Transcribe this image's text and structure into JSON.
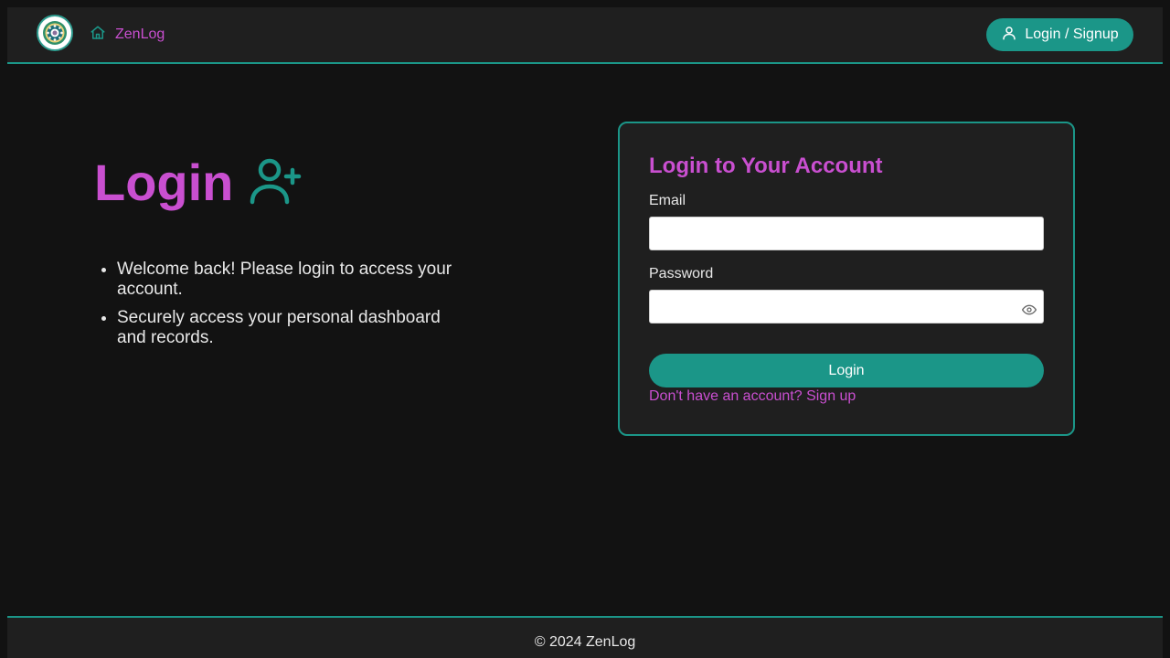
{
  "navbar": {
    "logo_icon": "mandala-logo-icon",
    "home_icon": "home-icon",
    "brand": "ZenLog",
    "button_icon": "user-icon",
    "button_label": "Login / Signup"
  },
  "hero": {
    "title": "Login",
    "title_icon": "user-plus-icon",
    "bullets": [
      "Welcome back! Please login to access your account.",
      "Securely access your personal dashboard and records."
    ]
  },
  "form": {
    "title": "Login to Your Account",
    "email_label": "Email",
    "email_value": "",
    "password_label": "Password",
    "password_value": "",
    "password_toggle_icon": "eye-icon",
    "submit_label": "Login",
    "signup_link": "Don't have an account? Sign up"
  },
  "footer": {
    "copyright": "© 2024 ZenLog"
  },
  "colors": {
    "background": "#121212",
    "panel": "#1f1f1f",
    "accent_teal": "#1b9688",
    "accent_magenta": "#c94fd0",
    "text": "#e8e8e8"
  }
}
